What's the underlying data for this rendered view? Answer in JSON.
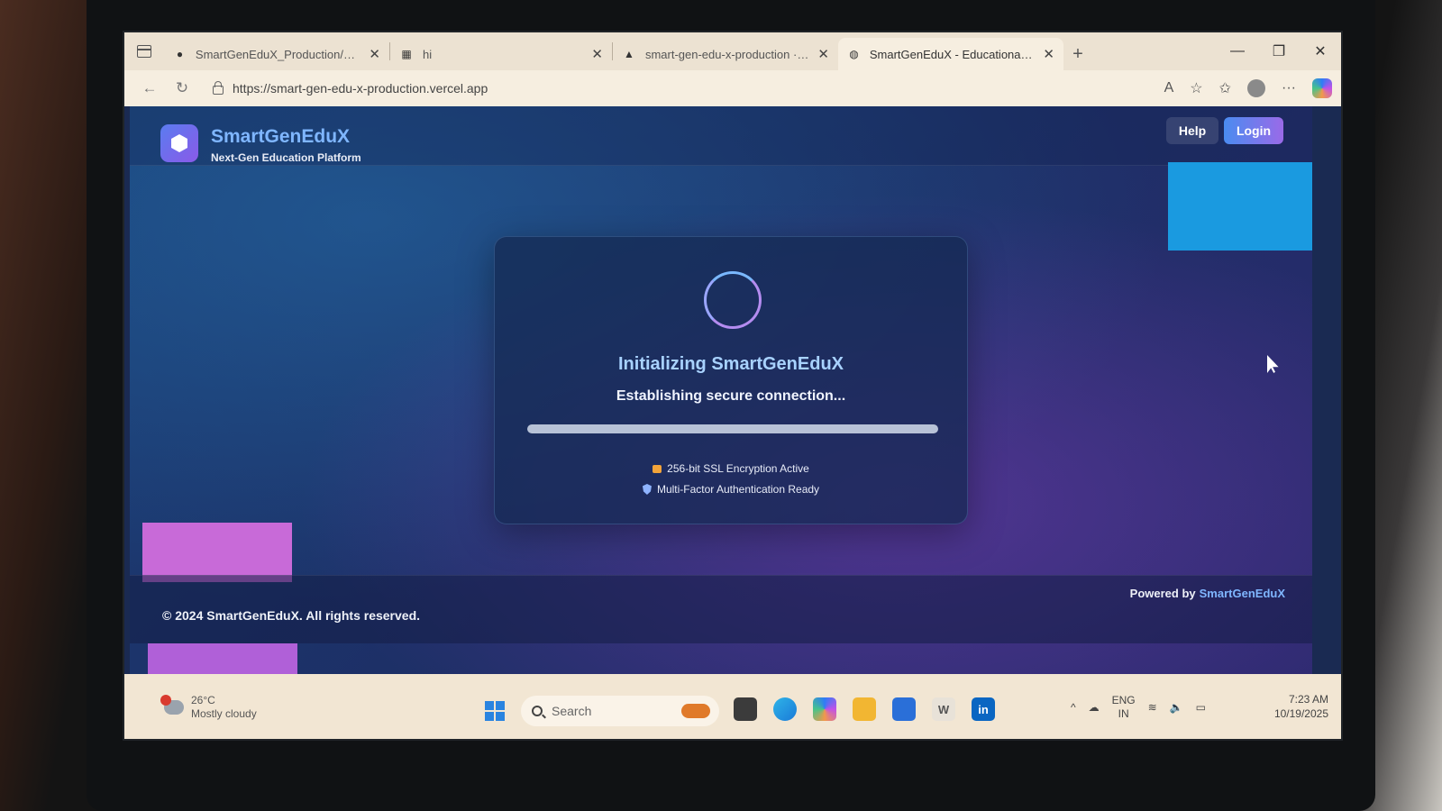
{
  "browser": {
    "tabs": [
      {
        "label": "SmartGenEduX_Production/verce",
        "icon": "github-icon"
      },
      {
        "label": "hi",
        "icon": "grid-icon"
      },
      {
        "label": "smart-gen-edu-x-production · O",
        "icon": "vercel-icon"
      },
      {
        "label": "SmartGenEduX - Educational Plat",
        "icon": "globe-icon",
        "active": true
      }
    ],
    "url": "https://smart-gen-edu-x-production.vercel.app"
  },
  "site": {
    "brand_name": "SmartGenEduX",
    "tagline": "Next-Gen Education Platform",
    "help_label": "Help",
    "login_label": "Login"
  },
  "loader": {
    "title": "Initializing SmartGenEduX",
    "subtitle": "Establishing secure connection...",
    "progress": 1.0,
    "security_items": [
      {
        "label": "256-bit SSL Encryption Active",
        "icon": "lock-icon"
      },
      {
        "label": "Multi-Factor Authentication Ready",
        "icon": "shield-icon"
      }
    ]
  },
  "footer": {
    "copyright": "© 2024 SmartGenEduX. All rights reserved.",
    "powered_prefix": "Powered by",
    "powered_brand": "SmartGenEduX"
  },
  "taskbar": {
    "temperature": "26°C",
    "weather": "Mostly cloudy",
    "search_placeholder": "Search",
    "lang_line1": "ENG",
    "lang_line2": "IN",
    "time": "7:23 AM",
    "date": "10/19/2025"
  },
  "colors": {
    "accent_blue": "#7fb6ff",
    "deco_blue": "#1a9ae0",
    "deco_purple": "#c86ad8"
  }
}
